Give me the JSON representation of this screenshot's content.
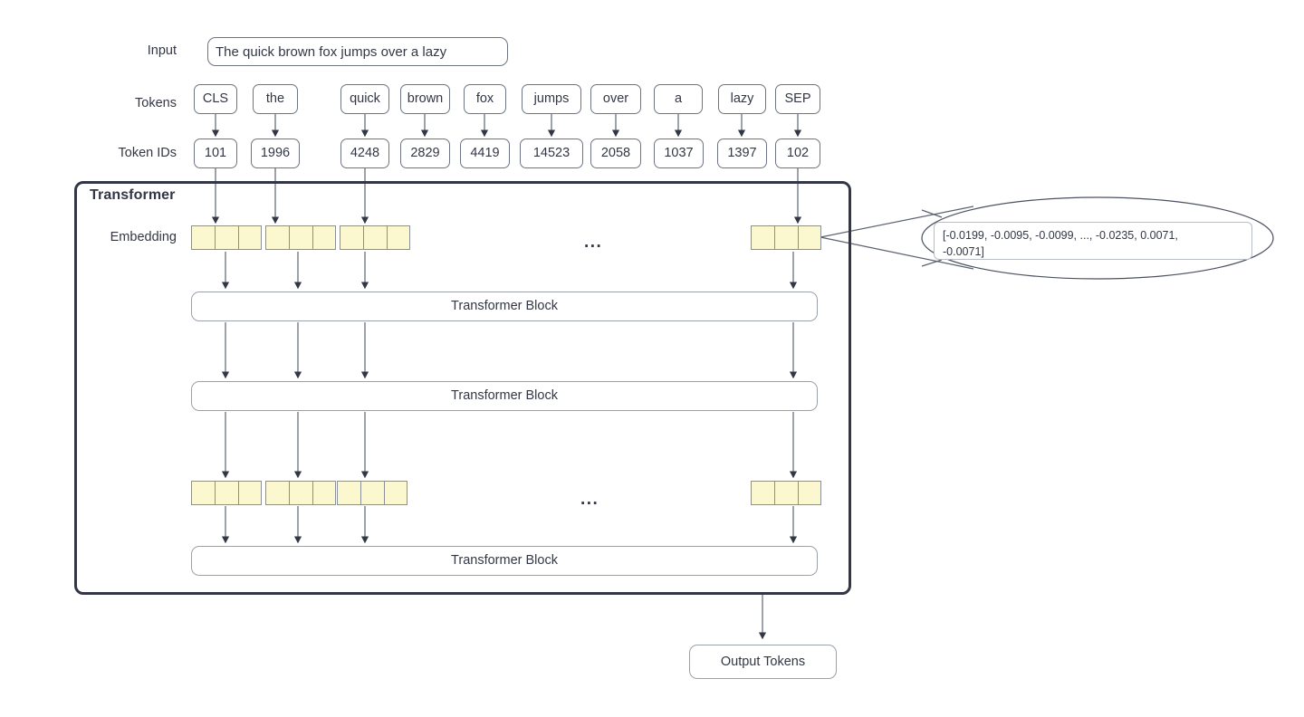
{
  "diagram": {
    "title": "Transformer tokenization and embedding pipeline",
    "container_label": "Transformer"
  },
  "colors": {
    "stroke": "#333745",
    "box_border": "#6d7585",
    "light_border": "#9aa1ad",
    "embedding_fill": "#fbf8d0",
    "embedding_border": "#8a9099",
    "background": "#ffffff"
  },
  "rows": {
    "input_label": "Input",
    "tokens_label": "Tokens",
    "token_ids_label": "Token IDs",
    "embedding_label": "Embedding"
  },
  "input": {
    "text": "The quick brown fox jumps over a lazy"
  },
  "tokens": [
    {
      "label": "CLS",
      "id": "101"
    },
    {
      "label": "the",
      "id": "1996"
    },
    {
      "label": "quick",
      "id": "4248"
    },
    {
      "label": "brown",
      "id": "2829"
    },
    {
      "label": "fox",
      "id": "4419"
    },
    {
      "label": "jumps",
      "id": "14523"
    },
    {
      "label": "over",
      "id": "2058"
    },
    {
      "label": "a",
      "id": "1037"
    },
    {
      "label": "lazy",
      "id": "1397"
    },
    {
      "label": "SEP",
      "id": "102"
    }
  ],
  "transformer_blocks": [
    {
      "label": "Transformer Block"
    },
    {
      "label": "Transformer Block"
    },
    {
      "label": "Transformer Block"
    }
  ],
  "ellipsis": {
    "upper": "...",
    "lower": "..."
  },
  "callout": {
    "vector_text": "[-0.0199, -0.0095, -0.0099,  ..., -0.0235,  0.0071,\n-0.0071]"
  },
  "output": {
    "label": "Output Tokens"
  }
}
